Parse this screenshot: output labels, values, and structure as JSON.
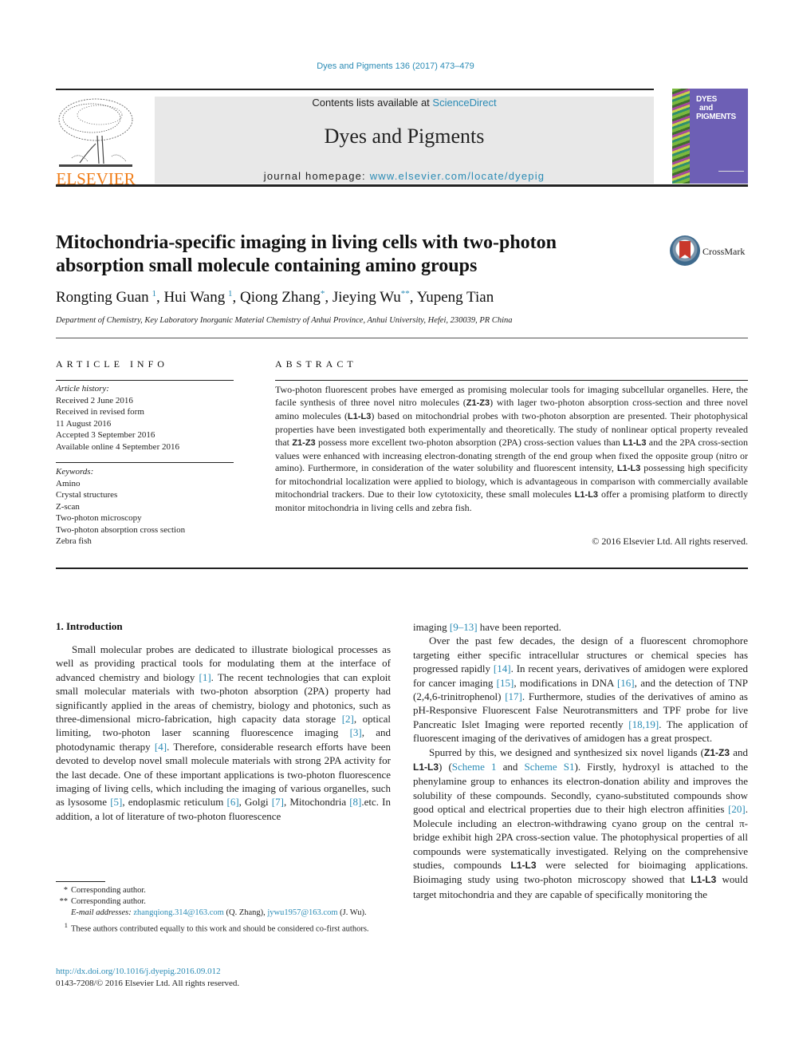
{
  "header": {
    "citation": "Dyes and Pigments 136 (2017) 473–479",
    "publisher_logo_text": "ELSEVIER",
    "contents_prefix": "Contents lists available at ",
    "contents_link": "ScienceDirect",
    "journal_name": "Dyes and Pigments",
    "homepage_prefix": "journal homepage: ",
    "homepage_link": "www.elsevier.com/locate/dyepig",
    "cover_title_lines": [
      "DYES",
      "and",
      "PIGMENTS"
    ],
    "accent_color": "#2a8bb5",
    "elsevier_color": "#f07e1a"
  },
  "article": {
    "title": "Mitochondria-specific imaging in living cells with two-photon absorption small molecule containing amino groups",
    "crossmark_label": "CrossMark",
    "authors": [
      {
        "name": "Rongting Guan",
        "mark": "1"
      },
      {
        "name": "Hui Wang",
        "mark": "1"
      },
      {
        "name": "Qiong Zhang",
        "mark": "*"
      },
      {
        "name": "Jieying Wu",
        "mark": "**"
      },
      {
        "name": "Yupeng Tian",
        "mark": ""
      }
    ],
    "affiliation": "Department of Chemistry, Key Laboratory Inorganic Material Chemistry of Anhui Province, Anhui University, Hefei, 230039, PR China"
  },
  "article_info": {
    "heading": "ARTICLE INFO",
    "history_label": "Article history:",
    "history": [
      "Received 2 June 2016",
      "Received in revised form",
      "11 August 2016",
      "Accepted 3 September 2016",
      "Available online 4 September 2016"
    ],
    "keywords_label": "Keywords:",
    "keywords": [
      "Amino",
      "Crystal structures",
      "Z-scan",
      "Two-photon microscopy",
      "Two-photon absorption cross section",
      "Zebra fish"
    ]
  },
  "abstract": {
    "heading": "ABSTRACT",
    "segments": [
      {
        "t": "Two-photon fluorescent probes have emerged as promising molecular tools for imaging subcellular organelles. Here, the facile synthesis of three novel nitro molecules ("
      },
      {
        "t": "Z1-Z3",
        "b": true
      },
      {
        "t": ") with lager two-photon absorption cross-section and three novel amino molecules ("
      },
      {
        "t": "L1-L3",
        "b": true
      },
      {
        "t": ") based on mitochondrial probes with two-photon absorption are presented. Their photophysical properties have been investigated both experimentally and theoretically. The study of nonlinear optical property revealed that "
      },
      {
        "t": "Z1-Z3",
        "b": true
      },
      {
        "t": " possess more excellent two-photon absorption (2PA) cross-section values than "
      },
      {
        "t": "L1-L3",
        "b": true
      },
      {
        "t": " and the 2PA cross-section values were enhanced with increasing electron-donating strength of the end group when fixed the opposite group (nitro or amino). Furthermore, in consideration of the water solubility and fluorescent intensity, "
      },
      {
        "t": "L1-L3",
        "b": true
      },
      {
        "t": " possessing high specificity for mitochondrial localization were applied to biology, which is advantageous in comparison with commercially available mitochondrial trackers. Due to their low cytotoxicity, these small molecules "
      },
      {
        "t": "L1-L3",
        "b": true
      },
      {
        "t": " offer a promising platform to directly monitor mitochondria in living cells and zebra fish."
      }
    ],
    "copyright": "© 2016 Elsevier Ltd. All rights reserved."
  },
  "introduction": {
    "heading": "1.  Introduction",
    "left_paragraphs": [
      [
        {
          "t": "Small molecular probes are dedicated to illustrate biological processes as well as providing practical tools for modulating them at the interface of advanced chemistry and biology "
        },
        {
          "t": "[1]",
          "link": true
        },
        {
          "t": ". The recent technologies that can exploit small molecular materials with two-photon absorption (2PA) property had significantly applied in the areas of chemistry, biology and photonics, such as three-dimensional micro-fabrication, high capacity data storage "
        },
        {
          "t": "[2]",
          "link": true
        },
        {
          "t": ", optical limiting, two-photon laser scanning fluorescence imaging "
        },
        {
          "t": "[3]",
          "link": true
        },
        {
          "t": ", and photodynamic therapy "
        },
        {
          "t": "[4]",
          "link": true
        },
        {
          "t": ". Therefore, considerable research efforts have been devoted to develop novel small molecule materials with strong 2PA activity for the last decade. One of these important applications is two-photon fluorescence imaging of living cells, which including the imaging of various organelles, such as lysosome "
        },
        {
          "t": "[5]",
          "link": true
        },
        {
          "t": ", endoplasmic reticulum "
        },
        {
          "t": "[6]",
          "link": true
        },
        {
          "t": ", Golgi "
        },
        {
          "t": "[7]",
          "link": true
        },
        {
          "t": ", Mitochondria "
        },
        {
          "t": "[8]",
          "link": true
        },
        {
          "t": ".etc. In addition, a lot of literature of two-photon fluorescence"
        }
      ]
    ],
    "right_paragraphs": [
      [
        {
          "t": "imaging "
        },
        {
          "t": "[9–13]",
          "link": true
        },
        {
          "t": " have been reported."
        }
      ],
      [
        {
          "t": "Over the past few decades, the design of a fluorescent chromophore targeting either specific intracellular structures or chemical species has progressed rapidly "
        },
        {
          "t": "[14]",
          "link": true
        },
        {
          "t": ". In recent years, derivatives of amidogen were explored for cancer imaging "
        },
        {
          "t": "[15]",
          "link": true
        },
        {
          "t": ", modifications in DNA "
        },
        {
          "t": "[16]",
          "link": true
        },
        {
          "t": ", and the detection of TNP (2,4,6-trinitrophenol) "
        },
        {
          "t": "[17]",
          "link": true
        },
        {
          "t": ". Furthermore, studies of the derivatives of amino as pH-Responsive Fluorescent False Neurotransmitters and TPF probe for live Pancreatic Islet Imaging were reported recently "
        },
        {
          "t": "[18,19]",
          "link": true
        },
        {
          "t": ". The application of fluorescent imaging of the derivatives of amidogen has a great prospect."
        }
      ],
      [
        {
          "t": "Spurred by this, we designed and synthesized six novel ligands ("
        },
        {
          "t": "Z1-Z3",
          "b": true
        },
        {
          "t": " and "
        },
        {
          "t": "L1-L3",
          "b": true
        },
        {
          "t": ") ("
        },
        {
          "t": "Scheme 1",
          "link": true
        },
        {
          "t": " and "
        },
        {
          "t": "Scheme S1",
          "link": true
        },
        {
          "t": "). Firstly, hydroxyl is attached to the phenylamine group to enhances its electron-donation ability and improves the solubility of these compounds. Secondly, cyano-substituted compounds show good optical and electrical properties due to their high electron affinities "
        },
        {
          "t": "[20]",
          "link": true
        },
        {
          "t": ". Molecule including an electron-withdrawing cyano group on the central π-bridge exhibit high 2PA cross-section value. The photophysical properties of all compounds were systematically investigated. Relying on the comprehensive studies, compounds "
        },
        {
          "t": "L1-L3",
          "b": true
        },
        {
          "t": " were selected for bioimaging applications. Bioimaging study using two-photon microscopy showed that "
        },
        {
          "t": "L1-L3",
          "b": true
        },
        {
          "t": " would target mitochondria and they are capable of specifically monitoring the"
        }
      ]
    ]
  },
  "footnotes": {
    "corresponding_1_mark": "*",
    "corresponding_1": "Corresponding author.",
    "corresponding_2_mark": "**",
    "corresponding_2": "Corresponding author.",
    "email_label": "E-mail addresses: ",
    "email_1": "zhangqiong.314@163.com",
    "email_1_owner": " (Q. Zhang), ",
    "email_2": "jywu1957@163.com",
    "email_2_owner": " (J. Wu).",
    "equal_mark": "1",
    "equal_contribution": "These authors contributed equally to this work and should be considered co-first authors."
  },
  "footer": {
    "doi": "http://dx.doi.org/10.1016/j.dyepig.2016.09.012",
    "issn": "0143-7208/© 2016 Elsevier Ltd. All rights reserved."
  }
}
